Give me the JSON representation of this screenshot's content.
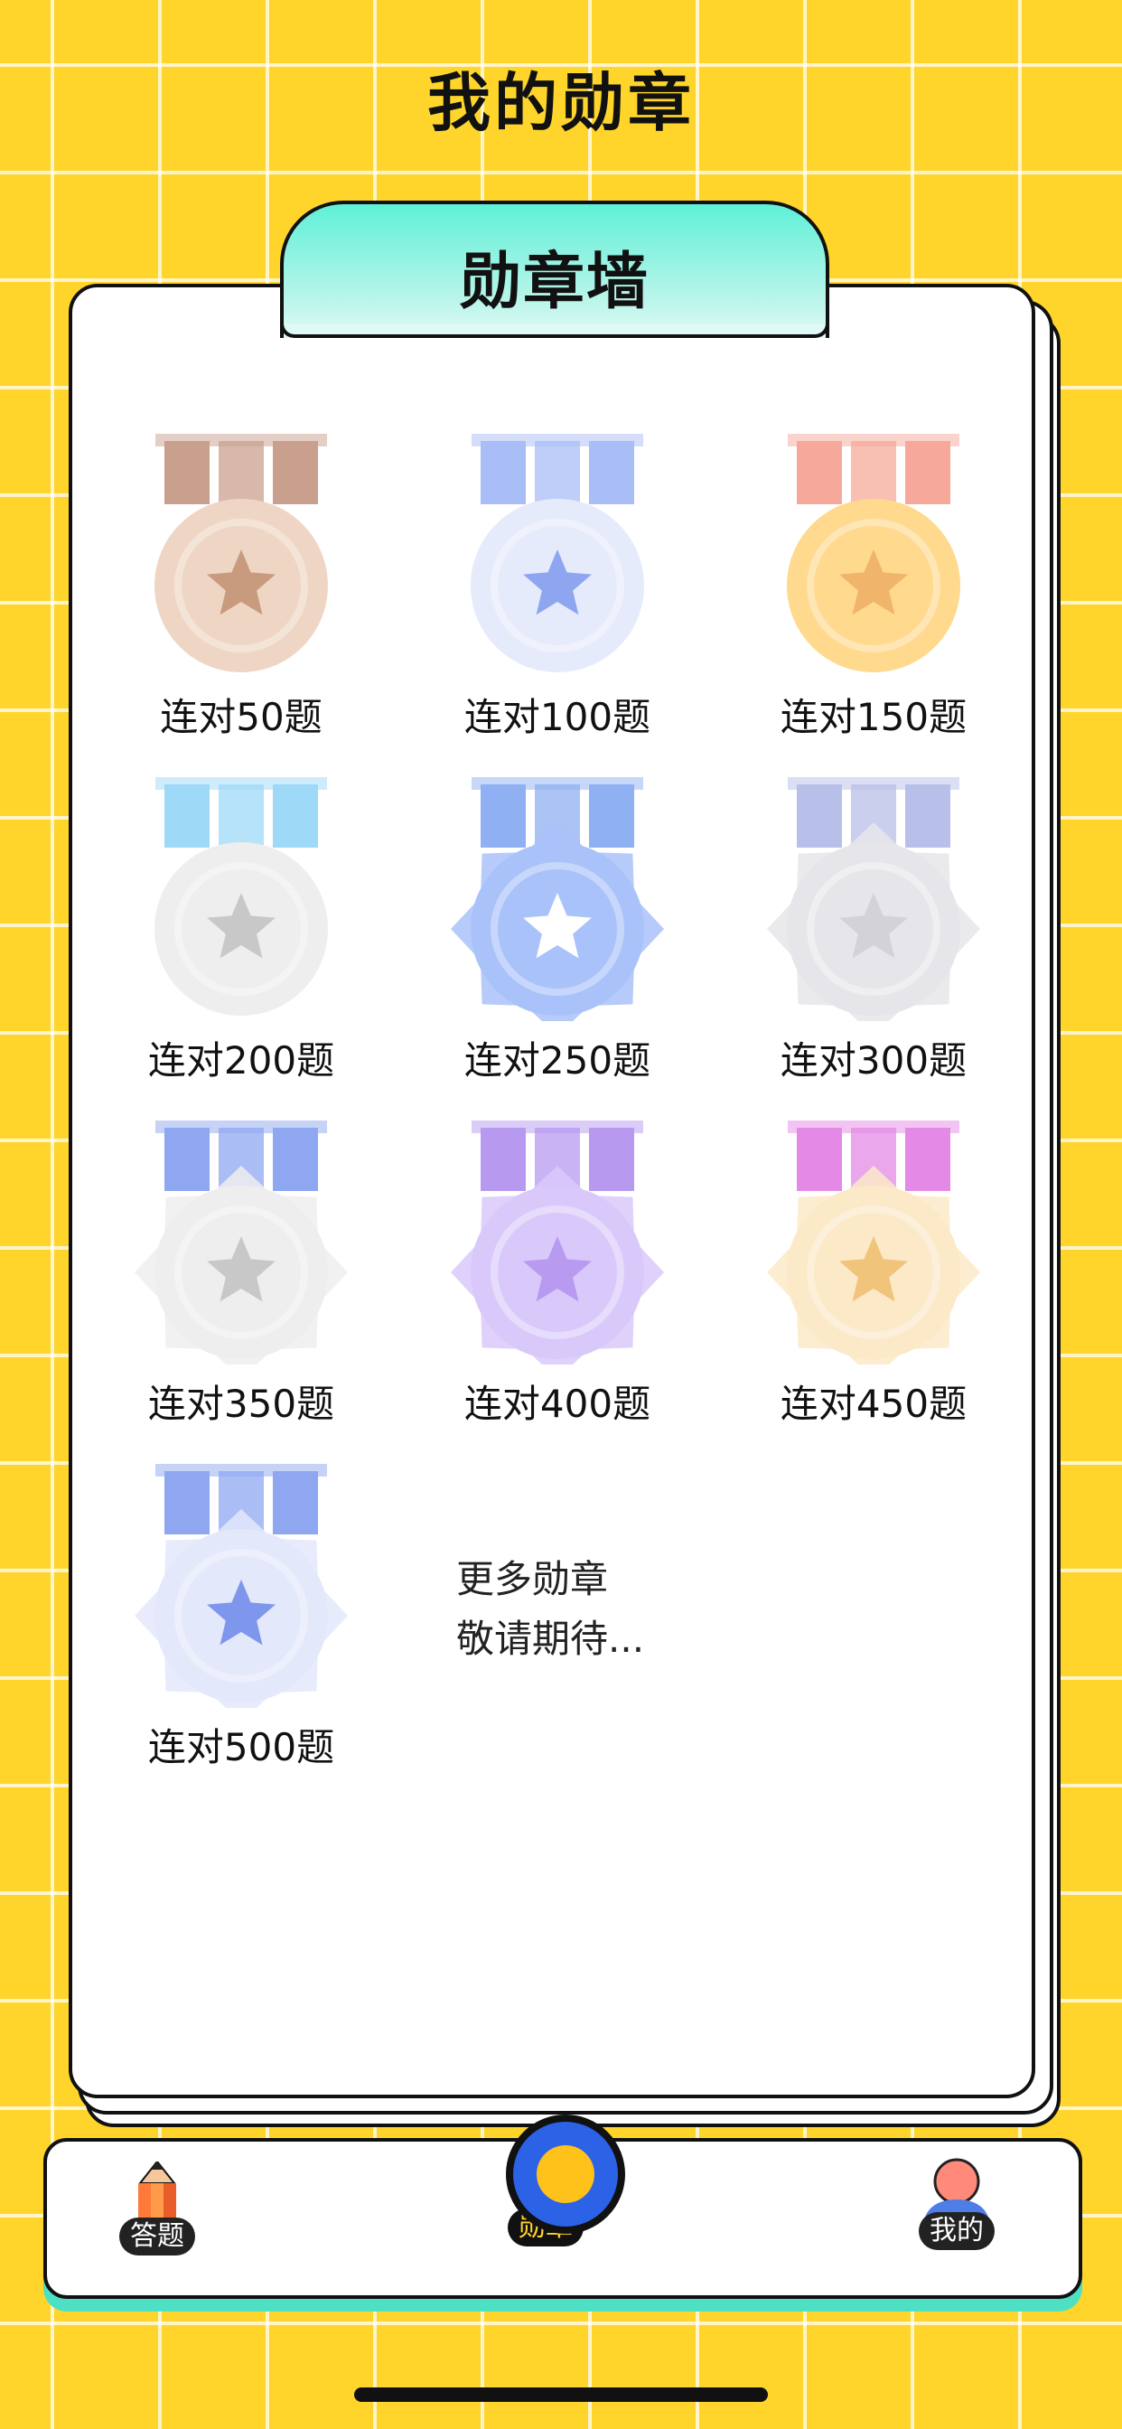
{
  "header": {
    "title": "我的勋章"
  },
  "wall": {
    "title": "勋章墙"
  },
  "medals": [
    {
      "label": "连对50题",
      "colors": {
        "ribbon": "#c9a08e",
        "face": "#efd6c4",
        "star": "#c99b7e"
      }
    },
    {
      "label": "连对100题",
      "colors": {
        "ribbon": "#a9bdf6",
        "face": "#e6ebfb",
        "star": "#8ea6ef"
      }
    },
    {
      "label": "连对150题",
      "colors": {
        "ribbon": "#f6a99a",
        "face": "#ffd98e",
        "star": "#f0b56a"
      }
    },
    {
      "label": "连对200题",
      "colors": {
        "ribbon": "#9ed9f7",
        "face": "#eeeeee",
        "star": "#c8c8c8"
      }
    },
    {
      "label": "连对250题",
      "colors": {
        "ribbon": "#8fb0f2",
        "face": "#a9c2f9",
        "star": "#ffffff"
      }
    },
    {
      "label": "连对300题",
      "colors": {
        "ribbon": "#b8bfe8",
        "face": "#e6e6ea",
        "star": "#d2d2d8"
      }
    },
    {
      "label": "连对350题",
      "colors": {
        "ribbon": "#8ea7f0",
        "face": "#eeeeee",
        "star": "#c8c8c8"
      }
    },
    {
      "label": "连对400题",
      "colors": {
        "ribbon": "#b79af0",
        "face": "#d9c9fa",
        "star": "#b89af0"
      }
    },
    {
      "label": "连对450题",
      "colors": {
        "ribbon": "#e48ae6",
        "face": "#fbe9c8",
        "star": "#f0c47a"
      }
    },
    {
      "label": "连对500题",
      "colors": {
        "ribbon": "#8ea7f0",
        "face": "#e3e8fb",
        "star": "#7e97ec"
      }
    }
  ],
  "more": {
    "line1": "更多勋章",
    "line2": "敬请期待..."
  },
  "nav": {
    "answer_label": "答题",
    "medal_label": "勋章",
    "mine_label": "我的",
    "icons": {
      "answer": "pencil-icon",
      "medal": "medal-icon",
      "mine": "user-icon"
    },
    "active": "勋章"
  },
  "colors": {
    "background": "#ffd52b",
    "accent": "#4ee0c4",
    "active_tab": "#2b62e6"
  }
}
